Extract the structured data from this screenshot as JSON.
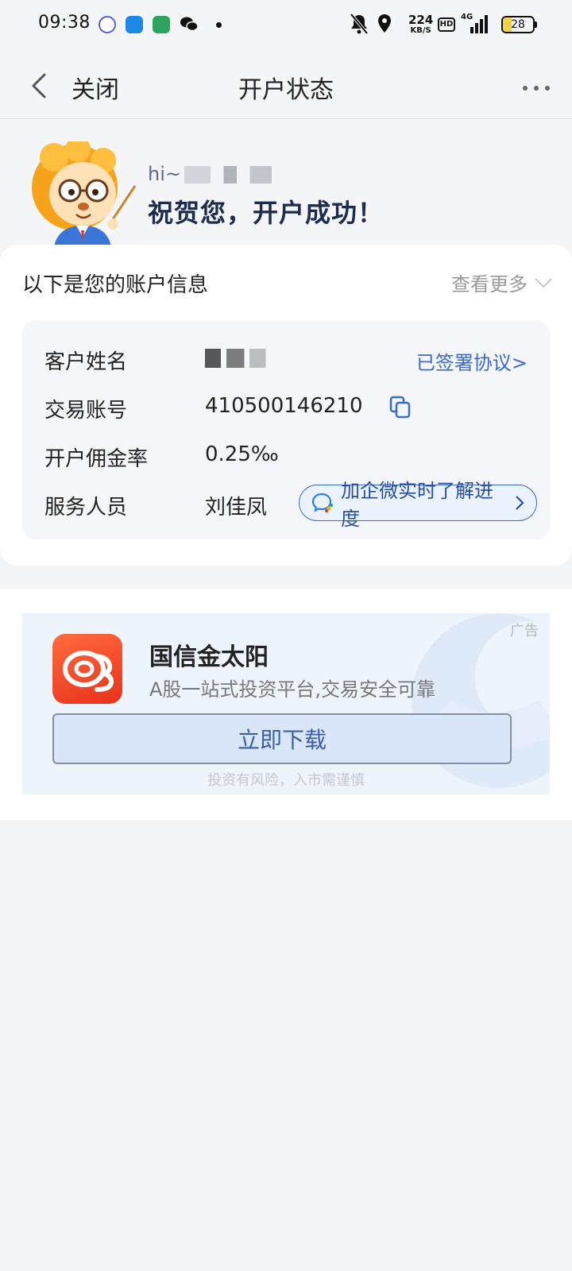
{
  "status_bar": {
    "time": "09:38",
    "net_speed_value": "224",
    "net_speed_unit": "KB/S",
    "hd_label": "HD",
    "network_label": "4G",
    "battery_level": "28"
  },
  "nav": {
    "close_label": "关闭",
    "title": "开户状态"
  },
  "hero": {
    "greeting_prefix": "hi~",
    "congrats": "祝贺您，开户成功！"
  },
  "account": {
    "header": "以下是您的账户信息",
    "see_more": "查看更多",
    "rows": [
      {
        "label": "客户姓名",
        "value": ""
      },
      {
        "label": "交易账号",
        "value": "410500146210"
      },
      {
        "label": "开户佣金率",
        "value": "0.25‰"
      },
      {
        "label": "服务人员",
        "value": "刘佳凤"
      }
    ],
    "signed_link": "已签署协议>",
    "wecom_button": "加企微实时了解进度"
  },
  "ad": {
    "tag": "广告",
    "title": "国信金太阳",
    "description": "A股一站式投资平台,交易安全可靠",
    "download_button": "立即下载",
    "risk_note": "投资有风险，入市需谨慎"
  },
  "colors": {
    "accent_blue": "#3b6bc9",
    "page_bg": "#f4f5f7",
    "ad_logo_orange": "#e8321c"
  }
}
